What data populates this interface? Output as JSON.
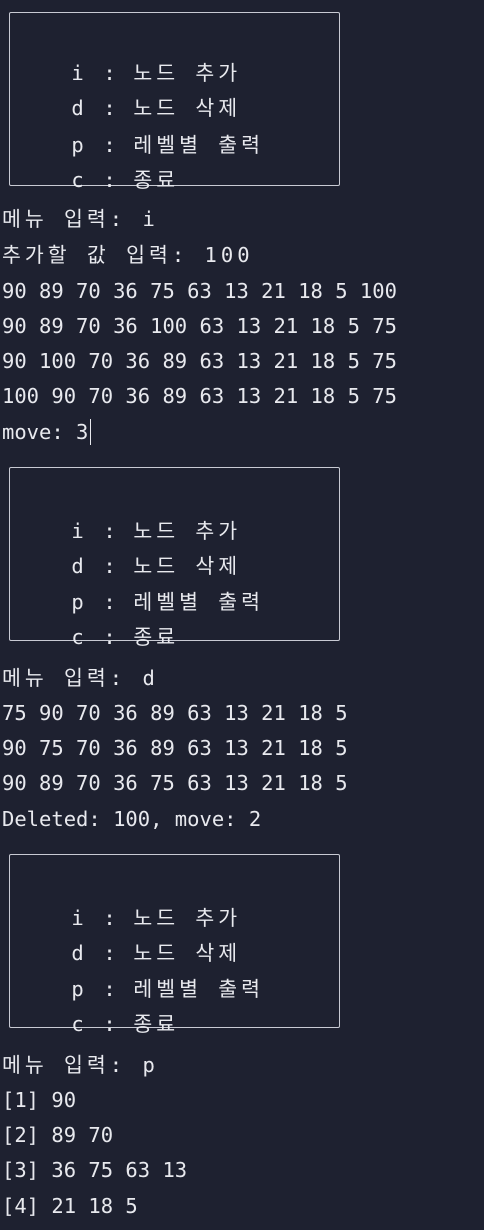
{
  "menu": {
    "items": [
      {
        "key": "i",
        "label": "노드 추가"
      },
      {
        "key": "d",
        "label": "노드 삭제"
      },
      {
        "key": "p",
        "label": "레벨별 출력"
      },
      {
        "key": "c",
        "label": "종료"
      }
    ],
    "separator": ":"
  },
  "session1": {
    "prompt": "메뉴 입력: i",
    "value_prompt": "추가할 값 입력: 100",
    "heap_states": [
      "90 89 70 36 75 63 13 21 18 5 100",
      "90 89 70 36 100 63 13 21 18 5 75",
      "90 100 70 36 89 63 13 21 18 5 75",
      "100 90 70 36 89 63 13 21 18 5 75"
    ],
    "result": "move: 3"
  },
  "session2": {
    "prompt": "메뉴 입력: d",
    "heap_states": [
      "75 90 70 36 89 63 13 21 18 5",
      "90 75 70 36 89 63 13 21 18 5",
      "90 89 70 36 75 63 13 21 18 5"
    ],
    "result": "Deleted: 100, move: 2"
  },
  "session3": {
    "prompt": "메뉴 입력: p",
    "levels": [
      "[1] 90",
      "[2] 89 70",
      "[3] 36 75 63 13",
      "[4] 21 18 5"
    ]
  }
}
